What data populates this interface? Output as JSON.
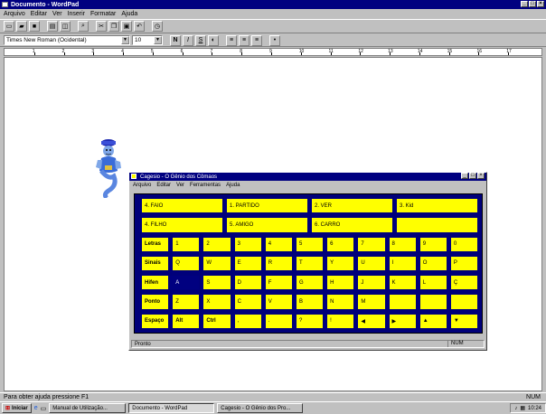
{
  "window": {
    "title": "Documento - WordPad"
  },
  "menu": [
    "Arquivo",
    "Editar",
    "Ver",
    "Inserir",
    "Formatar",
    "Ajuda"
  ],
  "format": {
    "font": "Times New Roman (Ocidental)",
    "size": "10"
  },
  "ruler": {
    "labels": [
      "1",
      "2",
      "3",
      "4",
      "5",
      "6",
      "7",
      "8",
      "9",
      "10",
      "11",
      "12",
      "13",
      "14",
      "15",
      "16",
      "17"
    ]
  },
  "statusbar": {
    "text": "Para obter ajuda pressione F1",
    "mode": "NUM"
  },
  "subwindow": {
    "title": "Cagesio - O Gênio dos Cômaos",
    "menu": [
      "Arquivo",
      "Editar",
      "Ver",
      "Ferramentas",
      "Ajuda"
    ],
    "rows": [
      [
        "4. FAIO",
        "1. PARTIDO",
        "2. VER",
        "3. Kid"
      ],
      [
        "4. FILHO",
        "5. AMIGO",
        "6. CARRO",
        ""
      ],
      [
        "Letras",
        "1",
        "2",
        "3",
        "4",
        "5",
        "6",
        "7",
        "8",
        "9",
        "0"
      ],
      [
        "Sinais",
        "Q",
        "W",
        "E",
        "R",
        "T",
        "Y",
        "U",
        "I",
        "O",
        "P"
      ],
      [
        "Hifen",
        "A",
        "S",
        "D",
        "F",
        "G",
        "H",
        "J",
        "K",
        "L",
        "Ç"
      ],
      [
        "Ponto",
        "Z",
        "X",
        "C",
        "V",
        "B",
        "N",
        "M",
        "",
        "",
        ""
      ],
      [
        "Espaço",
        "Alt",
        "Ctrl",
        ",",
        ".",
        "?",
        "!",
        "◀",
        "▶",
        "▲",
        "▼"
      ]
    ],
    "status": "Pronto",
    "status_right": "NUM"
  },
  "taskbar": {
    "start": "Iniciar",
    "items": [
      "Manual de Utilização...",
      "Documento - WordPad",
      "Cagesio - O Gênio dos Pro..."
    ],
    "clock": "10:24"
  },
  "colors": {
    "title": "#000080",
    "cell": "#ffff00",
    "grid": "#00007a"
  }
}
